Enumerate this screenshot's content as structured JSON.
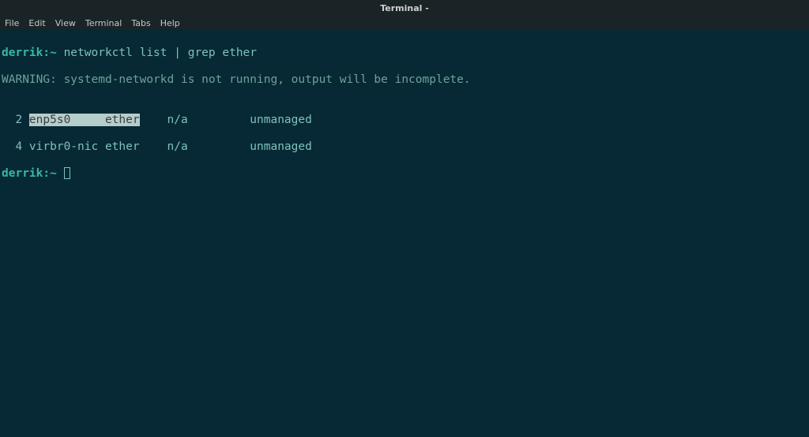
{
  "titlebar": {
    "title": "Terminal -"
  },
  "menubar": {
    "items": [
      "File",
      "Edit",
      "View",
      "Terminal",
      "Tabs",
      "Help"
    ]
  },
  "terminal": {
    "line1_prompt": "derrik:~",
    "line1_cmd": " networkctl list | grep ether",
    "line2": "WARNING: systemd-networkd is not running, output will be incomplete.",
    "blank": "",
    "row1_prefix": "  2 ",
    "row1_highlight": "enp5s0     ether",
    "row1_rest": "    n/a         unmanaged",
    "row2": "  4 virbr0-nic ether    n/a         unmanaged",
    "line_last_prompt": "derrik:~",
    "line_last_space": " "
  }
}
